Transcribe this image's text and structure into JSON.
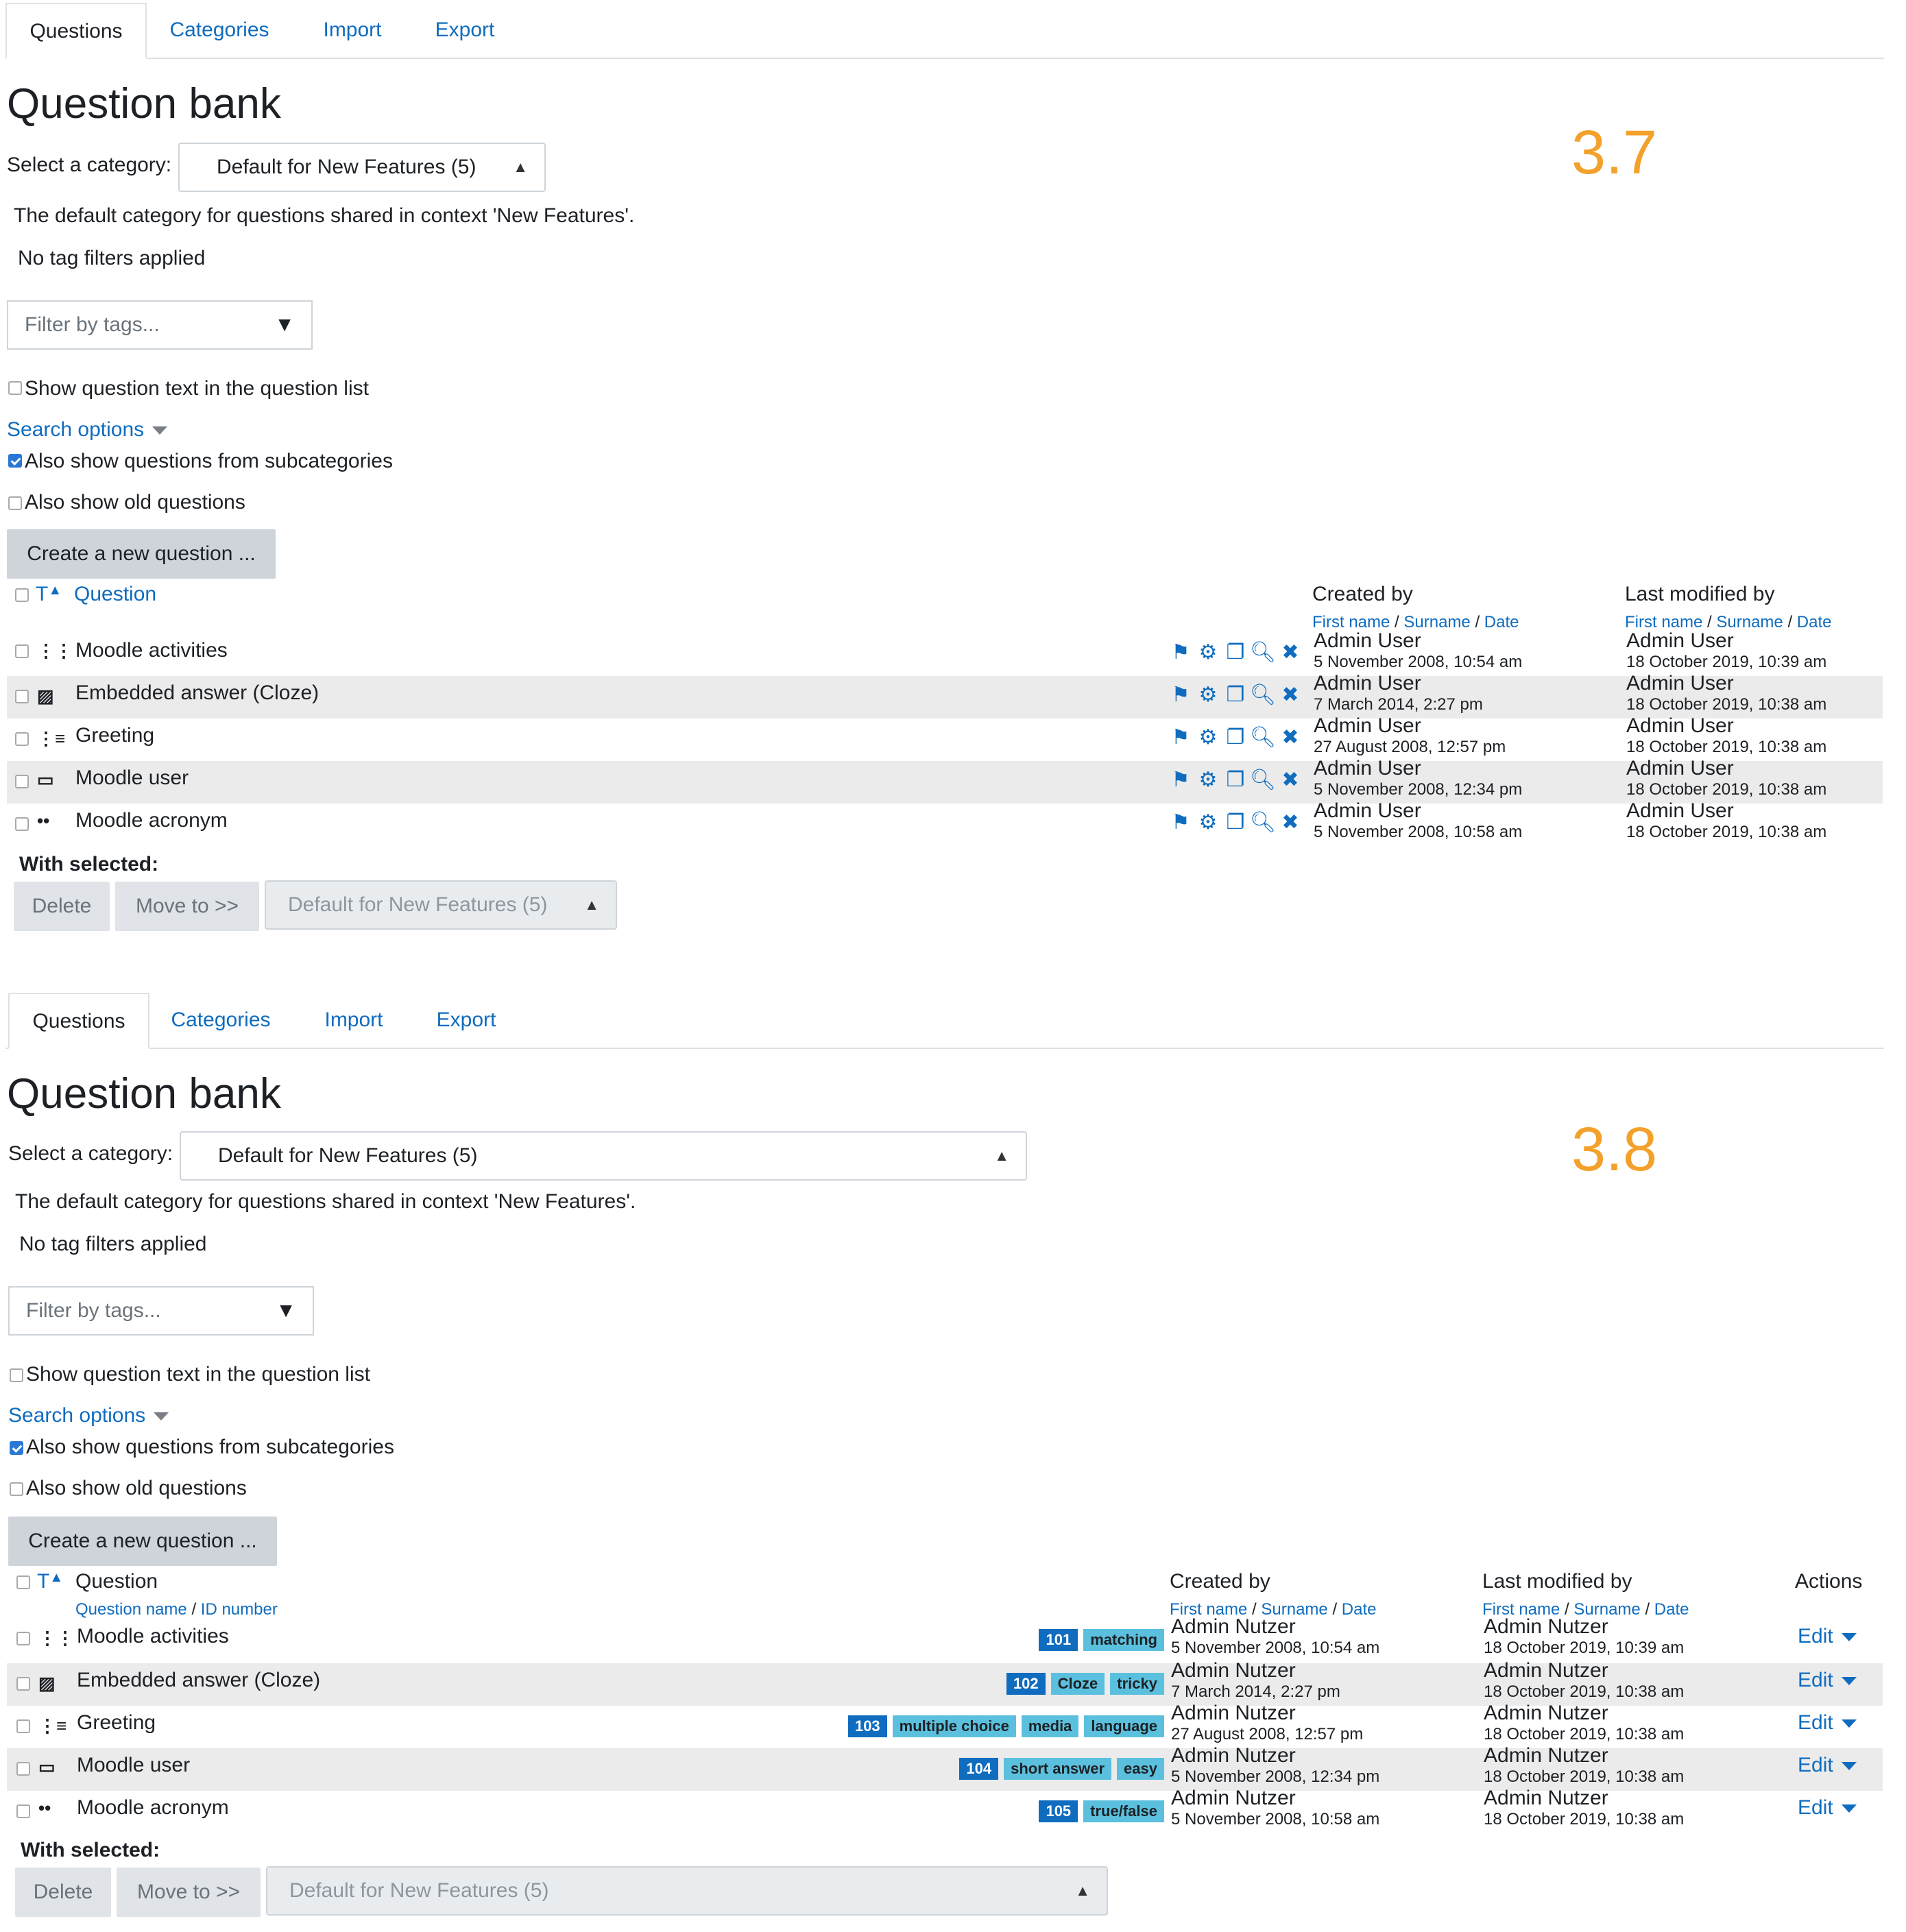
{
  "tabs": [
    {
      "label": "Questions"
    },
    {
      "label": "Categories"
    },
    {
      "label": "Import"
    },
    {
      "label": "Export"
    }
  ],
  "page_title": "Question bank",
  "select_category_label": "Select a category:",
  "category_value": "Default for New Features (5)",
  "category_description": "The default category for questions shared in context 'New Features'.",
  "tag_filter_status": "No tag filters applied",
  "tag_filter_placeholder": "Filter by tags...",
  "show_text_label": "Show question text in the question list",
  "search_options_label": "Search options",
  "subcategories_label": "Also show questions from subcategories",
  "old_questions_label": "Also show old questions",
  "create_button": "Create a new question ...",
  "header": {
    "type_sort": "T",
    "question": "Question",
    "question_name": "Question name",
    "id_number": "ID number",
    "slash": "/",
    "created_by": "Created by",
    "last_modified_by": "Last modified by",
    "actions": "Actions",
    "first_name": "First name",
    "surname": "Surname",
    "date": "Date"
  },
  "with_selected": "With selected:",
  "delete_button": "Delete",
  "move_button": "Move to >>",
  "move_target": "Default for New Features (5)",
  "colors": {
    "accent": "#0f6cbf",
    "version": "#f3a12b",
    "tag": "#5bc0de"
  },
  "v37": {
    "version": "3.7",
    "questions": [
      {
        "icon": "matching-icon",
        "name": "Moodle activities",
        "created_by": "Admin User",
        "created_date": "5 November 2008, 10:54 am",
        "modified_by": "Admin User",
        "modified_date": "18 October 2019, 10:39 am"
      },
      {
        "icon": "cloze-icon",
        "name": "Embedded answer (Cloze)",
        "created_by": "Admin User",
        "created_date": "7 March 2014, 2:27 pm",
        "modified_by": "Admin User",
        "modified_date": "18 October 2019, 10:38 am"
      },
      {
        "icon": "multichoice-icon",
        "name": "Greeting",
        "created_by": "Admin User",
        "created_date": "27 August 2008, 12:57 pm",
        "modified_by": "Admin User",
        "modified_date": "18 October 2019, 10:38 am"
      },
      {
        "icon": "shortanswer-icon",
        "name": "Moodle user",
        "created_by": "Admin User",
        "created_date": "5 November 2008, 12:34 pm",
        "modified_by": "Admin User",
        "modified_date": "18 October 2019, 10:38 am"
      },
      {
        "icon": "truefalse-icon",
        "name": "Moodle acronym",
        "created_by": "Admin User",
        "created_date": "5 November 2008, 10:58 am",
        "modified_by": "Admin User",
        "modified_date": "18 October 2019, 10:38 am"
      }
    ]
  },
  "v38": {
    "version": "3.8",
    "edit_label": "Edit",
    "questions": [
      {
        "icon": "matching-icon",
        "name": "Moodle activities",
        "id": "101",
        "tags": [
          "matching"
        ],
        "created_by": "Admin Nutzer",
        "created_date": "5 November 2008, 10:54 am",
        "modified_by": "Admin Nutzer",
        "modified_date": "18 October 2019, 10:39 am"
      },
      {
        "icon": "cloze-icon",
        "name": "Embedded answer (Cloze)",
        "id": "102",
        "tags": [
          "Cloze",
          "tricky"
        ],
        "created_by": "Admin Nutzer",
        "created_date": "7 March 2014, 2:27 pm",
        "modified_by": "Admin Nutzer",
        "modified_date": "18 October 2019, 10:38 am"
      },
      {
        "icon": "multichoice-icon",
        "name": "Greeting",
        "id": "103",
        "tags": [
          "multiple choice",
          "media",
          "language"
        ],
        "created_by": "Admin Nutzer",
        "created_date": "27 August 2008, 12:57 pm",
        "modified_by": "Admin Nutzer",
        "modified_date": "18 October 2019, 10:38 am"
      },
      {
        "icon": "shortanswer-icon",
        "name": "Moodle user",
        "id": "104",
        "tags": [
          "short answer",
          "easy"
        ],
        "created_by": "Admin Nutzer",
        "created_date": "5 November 2008, 12:34 pm",
        "modified_by": "Admin Nutzer",
        "modified_date": "18 October 2019, 10:38 am"
      },
      {
        "icon": "truefalse-icon",
        "name": "Moodle acronym",
        "id": "105",
        "tags": [
          "true/false"
        ],
        "created_by": "Admin Nutzer",
        "created_date": "5 November 2008, 10:58 am",
        "modified_by": "Admin Nutzer",
        "modified_date": "18 October 2019, 10:38 am"
      }
    ]
  }
}
